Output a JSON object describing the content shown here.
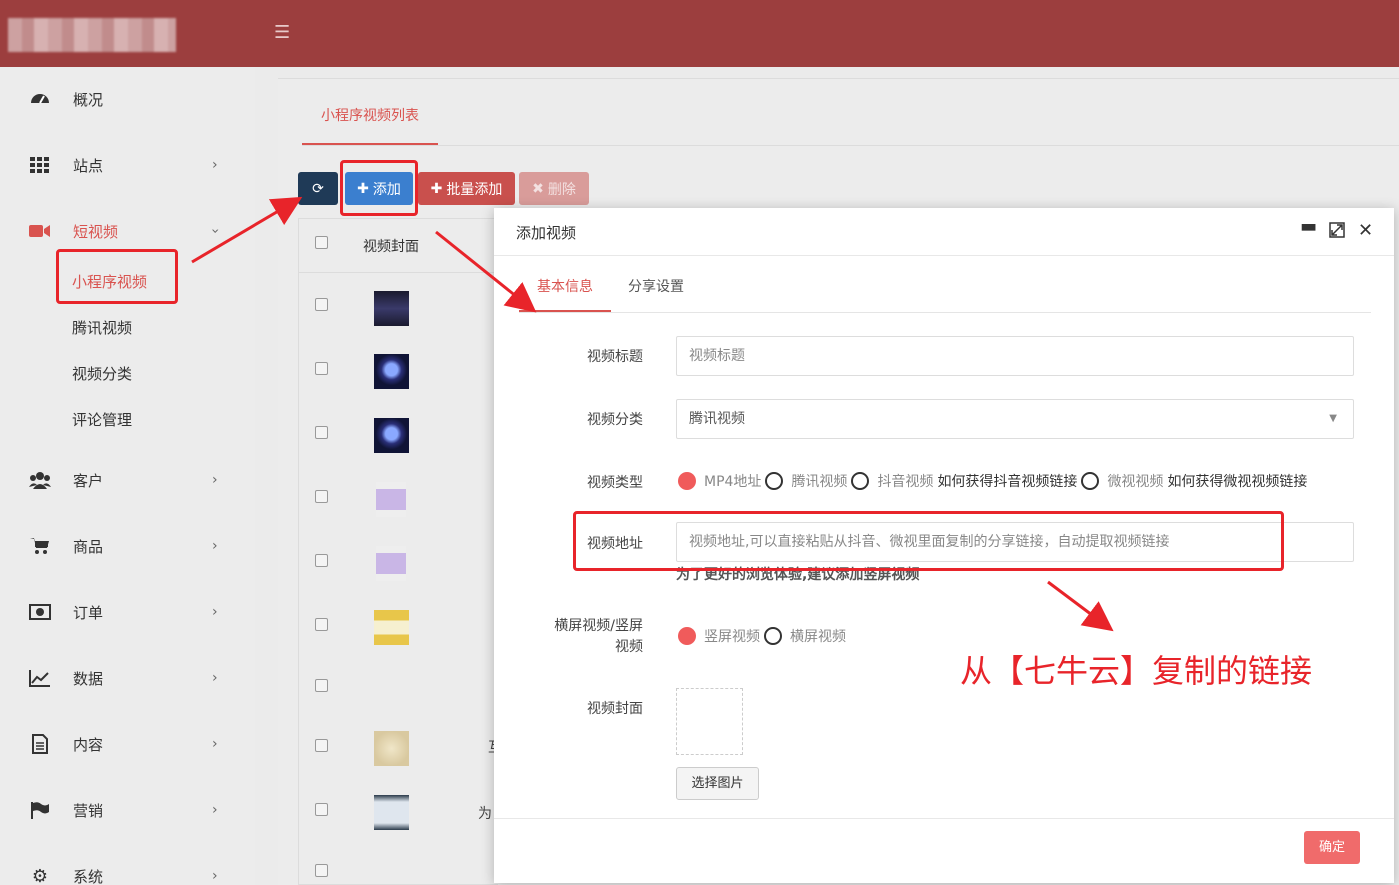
{
  "sidebar": {
    "items": [
      {
        "label": "概况",
        "icon": "dashboard-icon"
      },
      {
        "label": "站点",
        "icon": "grid-icon"
      },
      {
        "label": "短视频",
        "icon": "video-camera-icon"
      },
      {
        "label": "客户",
        "icon": "users-icon"
      },
      {
        "label": "商品",
        "icon": "cart-icon"
      },
      {
        "label": "订单",
        "icon": "money-icon"
      },
      {
        "label": "数据",
        "icon": "line-chart-icon"
      },
      {
        "label": "内容",
        "icon": "document-icon"
      },
      {
        "label": "营销",
        "icon": "flag-icon"
      },
      {
        "label": "系统",
        "icon": "gear-icon"
      }
    ],
    "sub_items": [
      "小程序视频",
      "腾讯视频",
      "视频分类",
      "评论管理"
    ]
  },
  "main": {
    "tab": "小程序视频列表",
    "toolbar": {
      "add": "添加",
      "batch_add": "批量添加",
      "delete": "删除"
    },
    "table": {
      "col_cover": "视频封面"
    },
    "clipped_text": {
      "row8": "互",
      "row9": "为"
    }
  },
  "modal": {
    "title": "添加视频",
    "tabs": [
      "基本信息",
      "分享设置"
    ],
    "fields": {
      "title_label": "视频标题",
      "title_placeholder": "视频标题",
      "category_label": "视频分类",
      "category_value": "腾讯视频",
      "type_label": "视频类型",
      "type_options": [
        "MP4地址",
        "腾讯视频",
        "抖音视频",
        "微视视频"
      ],
      "type_links": [
        "如何获得抖音视频链接",
        "如何获得微视视频链接"
      ],
      "url_label": "视频地址",
      "url_placeholder": "视频地址,可以直接粘贴从抖音、微视里面复制的分享链接，自动提取视频链接",
      "url_hint": "为了更好的浏览体验,建议添加竖屏视频",
      "orientation_label_1": "横屏视频/竖屏",
      "orientation_label_2": "视频",
      "orientation_options": [
        "竖屏视频",
        "横屏视频"
      ],
      "cover_label": "视频封面",
      "pick_image": "选择图片"
    },
    "confirm": "确定"
  },
  "annotation": "从【七牛云】复制的链接",
  "colors": {
    "topbar": "#9c3e3e",
    "accent": "#d9534f",
    "annotation": "#e8242a"
  }
}
